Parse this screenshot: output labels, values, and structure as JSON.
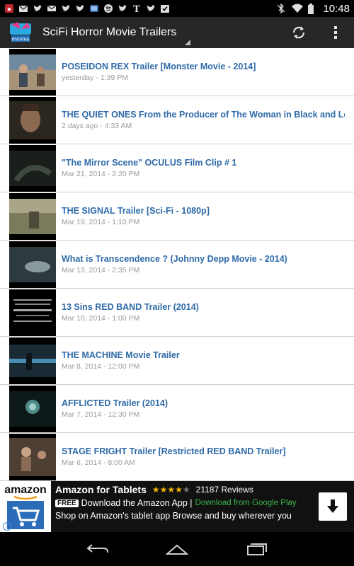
{
  "status_bar": {
    "time": "10:48",
    "left_icons": [
      "android-icon",
      "gmail-icon",
      "twitter-icon",
      "mail-icon",
      "twitter-icon",
      "twitter-icon",
      "sd-card-icon",
      "spotify-icon",
      "twitter-icon",
      "nytimes-icon",
      "twitter-icon",
      "download-icon"
    ],
    "right_icons": [
      "bluetooth-off-icon",
      "wifi-icon",
      "battery-icon"
    ]
  },
  "action_bar": {
    "app_icon_label": "movies",
    "title": "SciFi Horror Movie Trailers",
    "colors": {
      "background": "#272727",
      "title": "#ffffff"
    }
  },
  "list": {
    "items": [
      {
        "title": "POSEIDON REX Trailer [Monster Movie - 2014]",
        "date": "yesterday - 1:39 PM"
      },
      {
        "title": "THE QUIET ONES From the Producer of The Woman in Black and Let Me In",
        "date": "2 days ago - 4:33 AM"
      },
      {
        "title": "\"The Mirror Scene\" OCULUS Film Clip # 1",
        "date": "Mar 21, 2014 - 2:20 PM"
      },
      {
        "title": "THE SIGNAL Trailer [Sci-Fi - 1080p]",
        "date": "Mar 19, 2014 - 1:10 PM"
      },
      {
        "title": "What is Transcendence ? (Johnny Depp Movie - 2014)",
        "date": "Mar 13, 2014 - 2:35 PM"
      },
      {
        "title": "13 Sins RED BAND Trailer (2014)",
        "date": "Mar 10, 2014 - 1:00 PM"
      },
      {
        "title": "THE MACHINE Movie Trailer",
        "date": "Mar 8, 2014 - 12:00 PM"
      },
      {
        "title": "AFFLICTED Trailer (2014)",
        "date": "Mar 7, 2014 - 12:30 PM"
      },
      {
        "title": "STAGE FRIGHT Trailer [Restricted RED BAND Trailer]",
        "date": "Mar 6, 2014 - 8:00 AM"
      }
    ],
    "colors": {
      "title": "#2e6aa8",
      "date": "#9a9a9a"
    }
  },
  "ad": {
    "logo_text": "amazon",
    "title": "Amazon for Tablets",
    "rating": 4,
    "stars_text": "★★★★",
    "stars_off_text": "★",
    "reviews": "21187 Reviews",
    "badge": "FREE",
    "line2": "Download the Amazon App |",
    "source": "Download from Google Play",
    "line3": "Shop on Amazon's tablet app Browse and buy wherever you"
  }
}
